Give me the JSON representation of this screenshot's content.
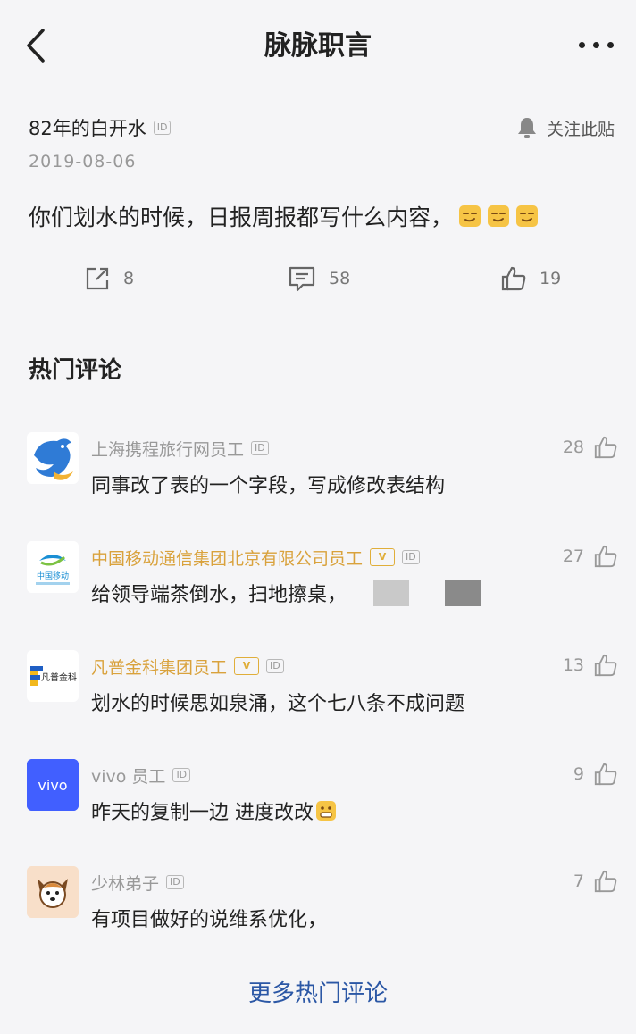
{
  "header": {
    "title": "脉脉职言"
  },
  "post": {
    "author": "82年的白开水",
    "id_badge": "ID",
    "follow_label": "关注此贴",
    "date": "2019-08-06",
    "content": "你们划水的时候，日报周报都写什么内容，",
    "shares": "8",
    "comments": "58",
    "likes": "19"
  },
  "comments_section": {
    "title": "热门评论",
    "verified_badge": "V",
    "items": [
      {
        "name": "上海携程旅行网员工",
        "text": "同事改了表的一个字段，写成修改表结构",
        "likes": "28"
      },
      {
        "name": "中国移动通信集团北京有限公司员工",
        "text": "给领导端茶倒水，扫地擦桌，",
        "likes": "27",
        "logo_text": "中国移动"
      },
      {
        "name": "凡普金科集团员工",
        "text": "划水的时候思如泉涌，这个七八条不成问题",
        "likes": "13",
        "logo_text": "凡普金科"
      },
      {
        "name": "vivo 员工",
        "text": "昨天的复制一边 进度改改",
        "likes": "9",
        "logo_text": "vivo"
      },
      {
        "name": "少林弟子",
        "text": "有项目做好的说维系优化，",
        "likes": "7"
      }
    ],
    "more_label": "更多热门评论"
  },
  "colors": {
    "accent_link": "#2b57a5",
    "verified_gold": "#d9a23c",
    "vivo_blue": "#415fff"
  }
}
